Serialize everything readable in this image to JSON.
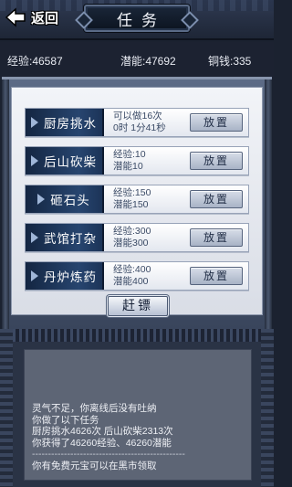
{
  "header": {
    "back_label": "返回",
    "title": "任务"
  },
  "stats": {
    "exp": "经验:46587",
    "potential": "潜能:47692",
    "money": "铜钱:335"
  },
  "tasks": [
    {
      "name": "厨房挑水",
      "info1": "可以做16次",
      "info2": "0时 1分41秒",
      "button": "放置"
    },
    {
      "name": "后山砍柴",
      "info1": "经验:10",
      "info2": "潜能10",
      "button": "放置"
    },
    {
      "name": "砸石头",
      "info1": "经验:150",
      "info2": "潜能150",
      "button": "放置"
    },
    {
      "name": "武馆打杂",
      "info1": "经验:300",
      "info2": "潜能300",
      "button": "放置"
    },
    {
      "name": "丹炉炼药",
      "info1": "经验:400",
      "info2": "潜能400",
      "button": "放置"
    }
  ],
  "escort_button": "赶镖",
  "log": {
    "lines": [
      "灵气不足，你离线后没有吐纳",
      "你做了以下任务",
      "厨房挑水4626次  后山砍柴2313次",
      "你获得了46260经验、46260潜能",
      "------------------------------------------------",
      "你有免费元宝可以在黑市领取"
    ]
  },
  "colors": {
    "header_bg": "#2f3a52",
    "task_plate": "#27456f",
    "panel_bg": "#f2f4f8",
    "log_bg": "#5d6575"
  }
}
